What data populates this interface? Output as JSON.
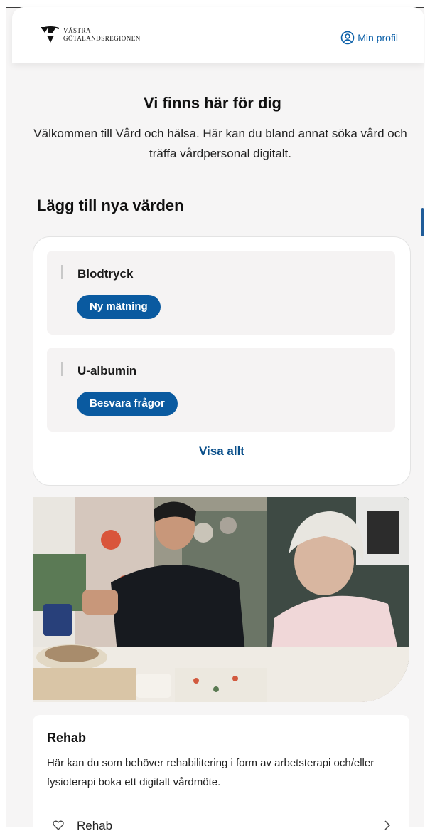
{
  "header": {
    "logo_line1": "VÄSTRA",
    "logo_line2": "GÖTALANDSREGIONEN",
    "profile_label": "Min profil"
  },
  "hero": {
    "title": "Vi finns här för dig",
    "text": "Välkommen till Vård och hälsa. Här kan du bland annat söka vård och träffa vårdpersonal digitalt."
  },
  "values": {
    "section_title": "Lägg till nya värden",
    "items": [
      {
        "name": "Blodtryck",
        "action": "Ny mätning"
      },
      {
        "name": "U-albumin",
        "action": "Besvara frågor"
      }
    ],
    "see_all": "Visa allt"
  },
  "rehab": {
    "title": "Rehab",
    "text": "Här kan du som behöver rehabilitering i form av arbetsterapi och/eller fysioterapi boka ett digitalt vårdmöte.",
    "link_label": "Rehab"
  },
  "colors": {
    "brand_blue": "#0a5aa0",
    "link_blue": "#0a4f8a",
    "page_bg": "#f6f5f5"
  },
  "icons": [
    "vgr-logo-icon",
    "profile-icon",
    "heart-icon",
    "chevron-right-icon"
  ]
}
